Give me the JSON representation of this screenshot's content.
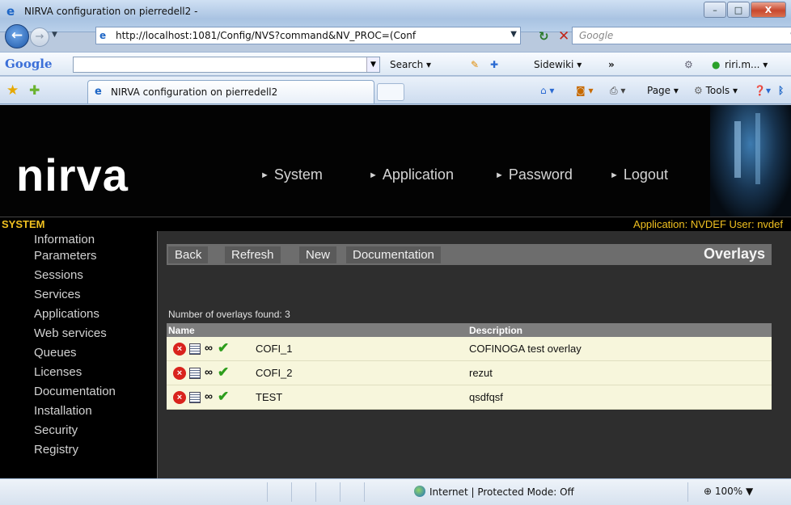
{
  "window": {
    "title": "NIRVA configuration on pierredell2 -",
    "minimize": "–",
    "maximize": "□",
    "close": "X"
  },
  "browser": {
    "address": "http://localhost:1081/Config/NVS?command&NV_PROC=(Conf",
    "search_placeholder": "Google",
    "google_toolbar": {
      "logo": "Google",
      "search_label": "Search",
      "sidewiki_label": "Sidewiki",
      "more_label": "»",
      "user_label": "riri.m..."
    },
    "tab_title": "NIRVA configuration on pierredell2",
    "commands": {
      "page": "Page",
      "tools": "Tools"
    },
    "status": {
      "zone": "Internet | Protected Mode: Off",
      "zoom": "100%"
    }
  },
  "app": {
    "logo": "nirva",
    "topnav": [
      "System",
      "Application",
      "Password",
      "Logout"
    ],
    "section": "SYSTEM",
    "app_info": "Application: NVDEF  User: nvdef",
    "sidebar": [
      "Information",
      "Parameters",
      "Sessions",
      "Services",
      "Applications",
      "Web services",
      "Queues",
      "Licenses",
      "Documentation",
      "Installation",
      "Security",
      "Registry"
    ],
    "toolbar": {
      "buttons": [
        "Back",
        "Refresh",
        "New",
        "Documentation"
      ],
      "title": "Overlays"
    },
    "count_text": "Number of overlays found: 3",
    "table": {
      "headers": [
        "Name",
        "Description"
      ],
      "rows": [
        {
          "name": "COFI_1",
          "description": "COFINOGA test overlay"
        },
        {
          "name": "COFI_2",
          "description": "rezut"
        },
        {
          "name": "TEST",
          "description": "qsdfqsf"
        }
      ]
    }
  },
  "icons": {
    "delete": "delete-icon",
    "list": "list-icon",
    "binoculars": "binoculars-icon",
    "check": "check-icon"
  },
  "colors": {
    "accent": "#f0c020",
    "row_bg": "#f7f6dc",
    "header_bg": "#030303"
  }
}
